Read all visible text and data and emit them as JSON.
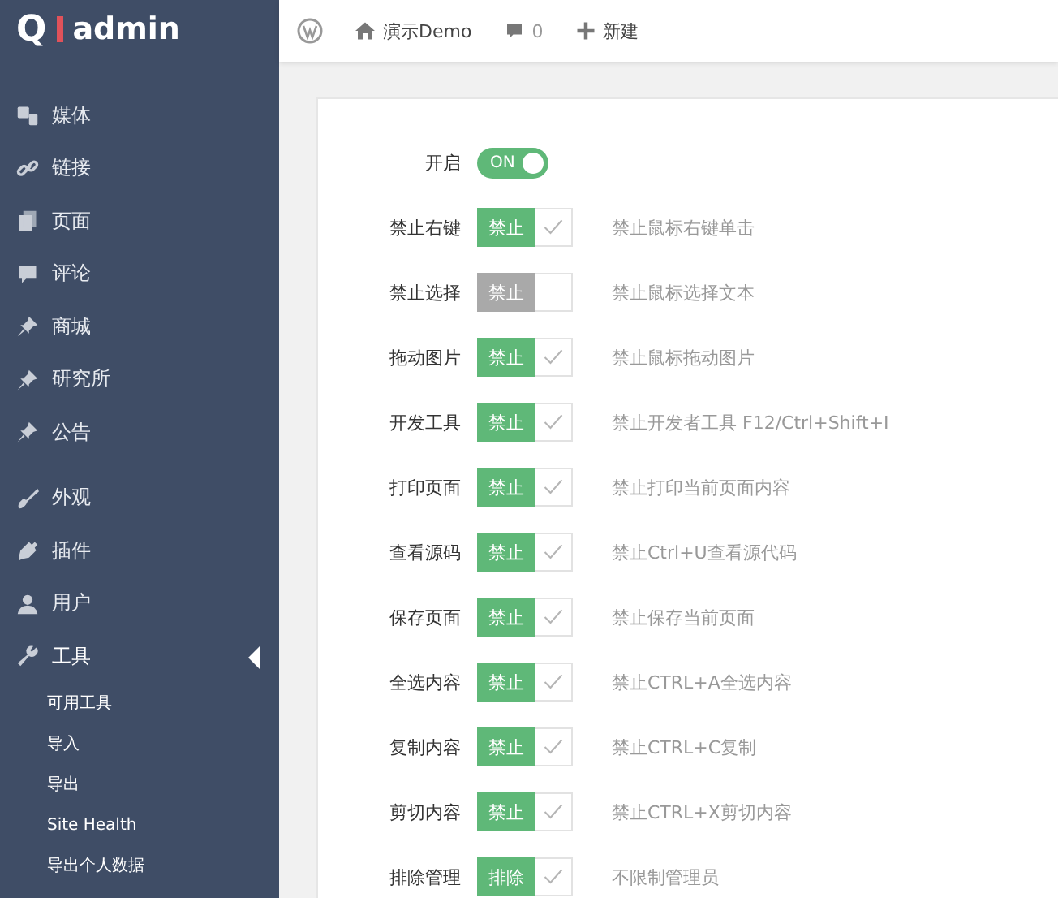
{
  "logo": {
    "letter": "Q",
    "name": "admin"
  },
  "sidebar": {
    "items": [
      {
        "label": "媒体",
        "selected": false
      },
      {
        "label": "链接",
        "selected": false
      },
      {
        "label": "页面",
        "selected": false
      },
      {
        "label": "评论",
        "selected": false
      },
      {
        "label": "商城",
        "selected": false
      },
      {
        "label": "研究所",
        "selected": false
      },
      {
        "label": "公告",
        "selected": false
      },
      {
        "label": "外观",
        "selected": false
      },
      {
        "label": "插件",
        "selected": false
      },
      {
        "label": "用户",
        "selected": false
      },
      {
        "label": "工具",
        "selected": true,
        "children": [
          {
            "label": "可用工具"
          },
          {
            "label": "导入"
          },
          {
            "label": "导出"
          },
          {
            "label": "Site Health"
          },
          {
            "label": "导出个人数据"
          }
        ]
      }
    ]
  },
  "topbar": {
    "site": "演示Demo",
    "comments": "0",
    "new": "新建"
  },
  "settings": [
    {
      "kind": "switch",
      "label": "开启",
      "on": true,
      "text": "ON"
    },
    {
      "kind": "check",
      "label": "禁止右键",
      "button": "禁止",
      "checked": true,
      "description": "禁止鼠标右键单击"
    },
    {
      "kind": "check",
      "label": "禁止选择",
      "button": "禁止",
      "checked": false,
      "description": "禁止鼠标选择文本"
    },
    {
      "kind": "check",
      "label": "拖动图片",
      "button": "禁止",
      "checked": true,
      "description": "禁止鼠标拖动图片"
    },
    {
      "kind": "check",
      "label": "开发工具",
      "button": "禁止",
      "checked": true,
      "description": "禁止开发者工具 F12/Ctrl+Shift+I"
    },
    {
      "kind": "check",
      "label": "打印页面",
      "button": "禁止",
      "checked": true,
      "description": "禁止打印当前页面内容"
    },
    {
      "kind": "check",
      "label": "查看源码",
      "button": "禁止",
      "checked": true,
      "description": "禁止Ctrl+U查看源代码"
    },
    {
      "kind": "check",
      "label": "保存页面",
      "button": "禁止",
      "checked": true,
      "description": "禁止保存当前页面"
    },
    {
      "kind": "check",
      "label": "全选内容",
      "button": "禁止",
      "checked": true,
      "description": "禁止CTRL+A全选内容"
    },
    {
      "kind": "check",
      "label": "复制内容",
      "button": "禁止",
      "checked": true,
      "description": "禁止CTRL+C复制"
    },
    {
      "kind": "check",
      "label": "剪切内容",
      "button": "禁止",
      "checked": true,
      "description": "禁止CTRL+X剪切内容"
    },
    {
      "kind": "check",
      "label": "排除管理",
      "button": "排除",
      "checked": true,
      "description": "不限制管理员"
    }
  ]
}
